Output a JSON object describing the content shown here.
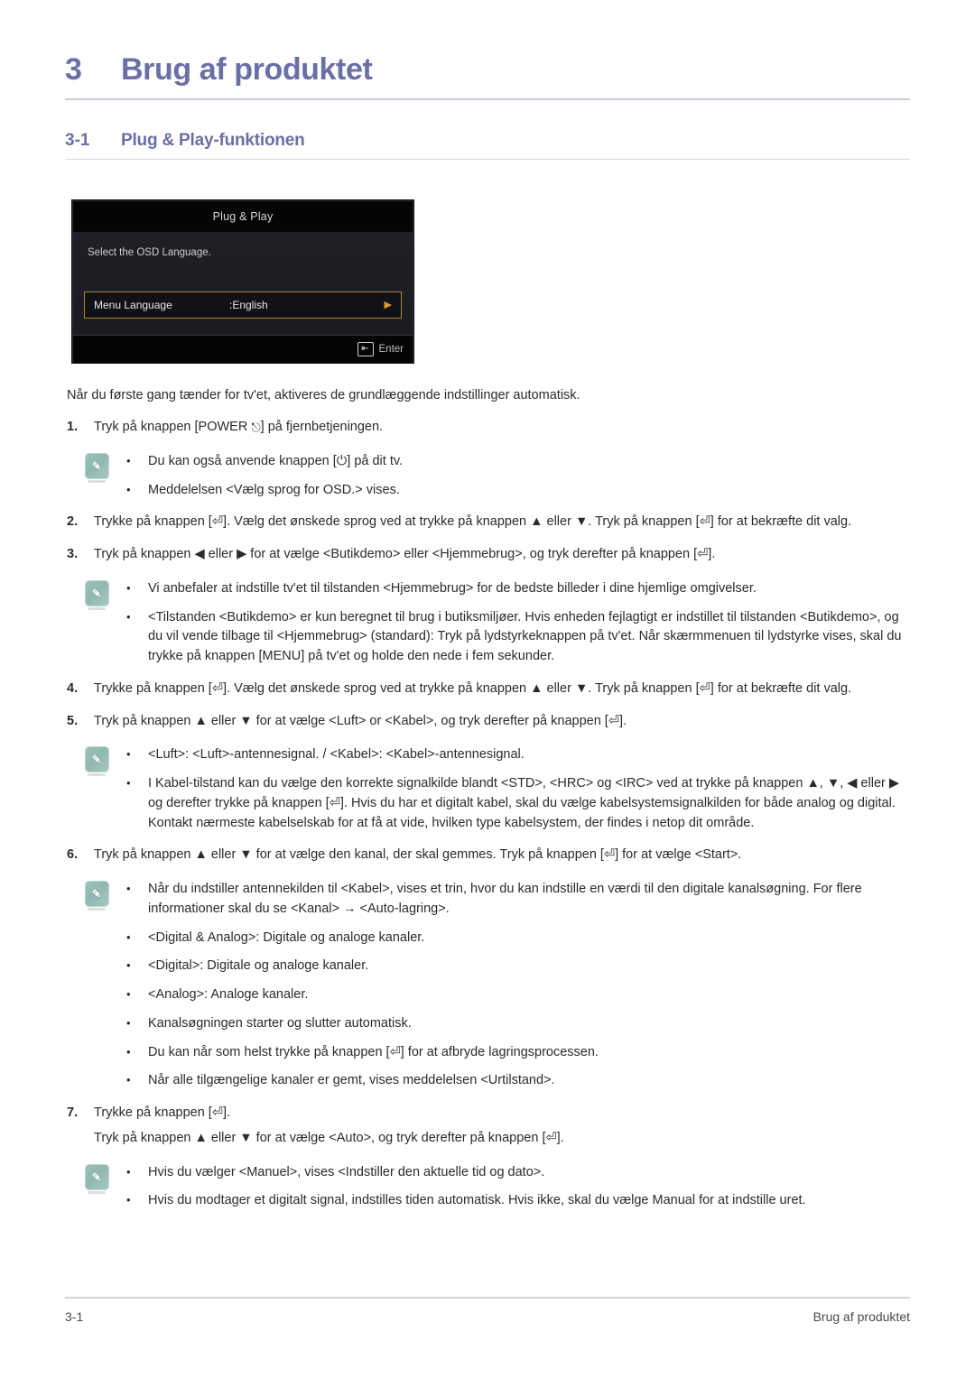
{
  "chapter": {
    "number": "3",
    "title": "Brug af produktet"
  },
  "section": {
    "number": "3-1",
    "title": "Plug & Play-funktionen"
  },
  "osd": {
    "title": "Plug & Play",
    "subtitle": "Select the OSD Language.",
    "row_label": "Menu Language",
    "row_value": ":English",
    "row_arrow_icon": "triangle-right-icon",
    "enter_key_icon": "enter-key-icon",
    "enter_label": "Enter",
    "colors": {
      "titlebar": "#050506",
      "body": "#1e2026",
      "highlight_border": "#b5812e",
      "arrow": "#e09a2a"
    }
  },
  "intro": "Når du første gang tænder for tv'et, aktiveres de grundlæggende indstillinger automatisk.",
  "steps": [
    {
      "num": "1.",
      "text_before": "Tryk på knappen [POWER ",
      "text_after": "] på fjernbetjeningen.",
      "has_power_glyph": true
    },
    {
      "num": "2.",
      "text": "Trykke på knappen [⏎]. Vælg det ønskede sprog ved at trykke på knappen ▲ eller ▼. Tryk på knappen [⏎] for at bekræfte dit valg."
    },
    {
      "num": "3.",
      "text": "Tryk på knappen ◀ eller ▶ for at vælge <Butikdemo> eller <Hjemmebrug>, og tryk derefter på knappen [⏎]."
    },
    {
      "num": "4.",
      "text": "Trykke på knappen [⏎]. Vælg det ønskede sprog ved at trykke på knappen ▲ eller ▼. Tryk på knappen [⏎] for at bekræfte dit valg."
    },
    {
      "num": "5.",
      "text": "Tryk på knappen ▲ eller ▼ for at vælge <Luft> or <Kabel>, og tryk derefter på knappen [⏎]."
    },
    {
      "num": "6.",
      "text": "Tryk på knappen ▲ eller ▼ for at vælge den kanal, der skal gemmes. Tryk på knappen [⏎] for at vælge <Start>."
    },
    {
      "num": "7.",
      "text": "Trykke på knappen [⏎].",
      "continuation": "Tryk på knappen ▲ eller ▼ for at vælge <Auto>, og tryk derefter på knappen [⏎]."
    }
  ],
  "notes": {
    "note1": {
      "icon": "pencil-note-icon",
      "items": [
        "Du kan også anvende knappen [⏻] på dit tv.",
        "Meddelelsen <Vælg sprog for OSD.> vises."
      ]
    },
    "note2": {
      "icon": "pencil-note-icon",
      "items": [
        "Vi anbefaler at indstille tv'et til tilstanden <Hjemmebrug> for de bedste billeder i dine hjemlige omgivelser.",
        "<Tilstanden <Butikdemo> er kun beregnet til brug i butiksmiljøer. Hvis enheden fejlagtigt er indstillet til tilstanden <Butikdemo>, og du vil vende tilbage til <Hjemmebrug> (standard): Tryk på lydstyrkeknappen på tv'et. Når skærmmenuen til lydstyrke vises, skal du trykke på knappen [MENU] på tv'et og holde den nede i fem sekunder."
      ]
    },
    "note3": {
      "icon": "pencil-note-icon",
      "items": [
        "<Luft>: <Luft>-antennesignal. / <Kabel>: <Kabel>-antennesignal.",
        "I Kabel-tilstand kan du vælge den korrekte signalkilde blandt <STD>, <HRC> og <IRC> ved at trykke på knappen ▲, ▼, ◀ eller ▶ og derefter trykke på knappen [⏎]. Hvis du har et digitalt kabel, skal du vælge kabelsystemsignalkilden for både analog og digital. Kontakt nærmeste kabelselskab for at få at vide, hvilken type kabelsystem, der findes i netop dit område."
      ]
    },
    "note4": {
      "icon": "pencil-note-icon",
      "items": [
        "Når du indstiller antennekilden til <Kabel>, vises et trin, hvor du kan indstille en værdi til den digitale kanalsøgning. For flere informationer skal du se <Kanal> → <Auto-lagring>.",
        "<Digital & Analog>: Digitale og analoge kanaler.",
        "<Digital>: Digitale og analoge kanaler.",
        "<Analog>: Analoge kanaler.",
        "Kanalsøgningen starter og slutter automatisk.",
        "Du kan når som helst trykke på knappen [⏎] for at afbryde lagringsprocessen.",
        "Når alle tilgængelige kanaler er gemt, vises meddelelsen <Urtilstand>."
      ]
    },
    "note5": {
      "icon": "pencil-note-icon",
      "items": [
        "Hvis du vælger <Manuel>, vises <Indstiller den aktuelle tid og dato>.",
        "Hvis du modtager et digitalt signal, indstilles tiden automatisk. Hvis ikke, skal du vælge Manual for at indstille uret."
      ]
    }
  },
  "footer": {
    "left": "3-1",
    "right": "Brug af produktet"
  },
  "theme": {
    "heading_color": "#6a6fa8",
    "note_chip_color": "#9dc3bb",
    "text_color": "#2b2b2b"
  }
}
